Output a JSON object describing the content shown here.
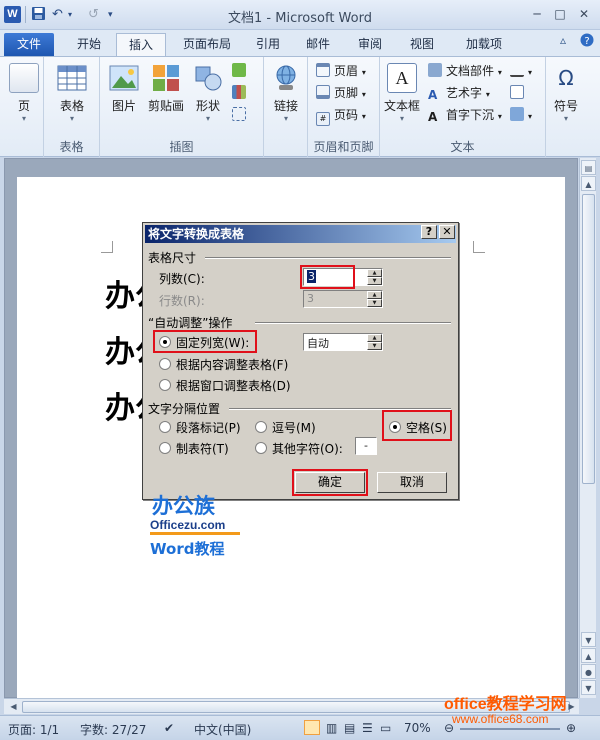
{
  "titlebar": {
    "app_icon": "W",
    "save_icon": "floppy-disk-icon",
    "undo_glyph": "↶",
    "redo_glyph": "↺",
    "customize_glyph": "▾",
    "title": "文档1 - Microsoft Word",
    "minimize": "─",
    "maximize": "□",
    "close": "✕"
  },
  "tabs": [
    "文件",
    "开始",
    "插入",
    "页面布局",
    "引用",
    "邮件",
    "审阅",
    "视图",
    "加载项"
  ],
  "active_tab": "插入",
  "ribbon": {
    "pages": {
      "label": "页"
    },
    "tables": {
      "button": "表格",
      "group": "表格"
    },
    "illustrations": {
      "group": "插图",
      "picture": "图片",
      "clipart": "剪贴画",
      "shapes": "形状"
    },
    "links": {
      "button": "链接"
    },
    "header_footer": {
      "group": "页眉和页脚",
      "header": "页眉",
      "footer": "页脚",
      "page_number": "页码"
    },
    "text": {
      "group": "文本",
      "textbox": "文本框",
      "quickparts": "文档部件",
      "wordart": "艺术字",
      "dropcap": "首字下沉"
    },
    "symbols": {
      "symbol": "符号",
      "glyph": "Ω"
    }
  },
  "document": {
    "lines": [
      "办公族",
      "办公族",
      "办公族"
    ]
  },
  "dialog": {
    "title": "将文字转换成表格",
    "help_btn": "?",
    "close_btn": "✕",
    "table_size_label": "表格尺寸",
    "columns_label": "列数(C):",
    "columns_value": "3",
    "rows_label": "行数(R):",
    "rows_value": "3",
    "autofit_label": "“自动调整”操作",
    "fixed_width_label": "固定列宽(W):",
    "fixed_width_value": "自动",
    "autofit_content": "根据内容调整表格(F)",
    "autofit_window": "根据窗口调整表格(D)",
    "separator_label": "文字分隔位置",
    "sep_paragraph": "段落标记(P)",
    "sep_comma": "逗号(M)",
    "sep_space": "空格(S)",
    "sep_tab": "制表符(T)",
    "sep_other": "其他字符(O):",
    "other_char": "-",
    "ok": "确定",
    "cancel": "取消"
  },
  "logo": {
    "brand": "办公族",
    "site": "Officezu.com",
    "course": "Word教程"
  },
  "statusbar": {
    "page": "页面: 1/1",
    "words": "字数: 27/27",
    "language": "中文(中国)",
    "zoom": "70%"
  },
  "watermark": {
    "line1": "office教程学习网",
    "line2": "www.office68.com"
  },
  "colors": {
    "highlight": "#e0101a",
    "dialog_bg": "#d4d0c8",
    "watermark": "#ff5a00",
    "file_tab": "#2a62c0"
  }
}
